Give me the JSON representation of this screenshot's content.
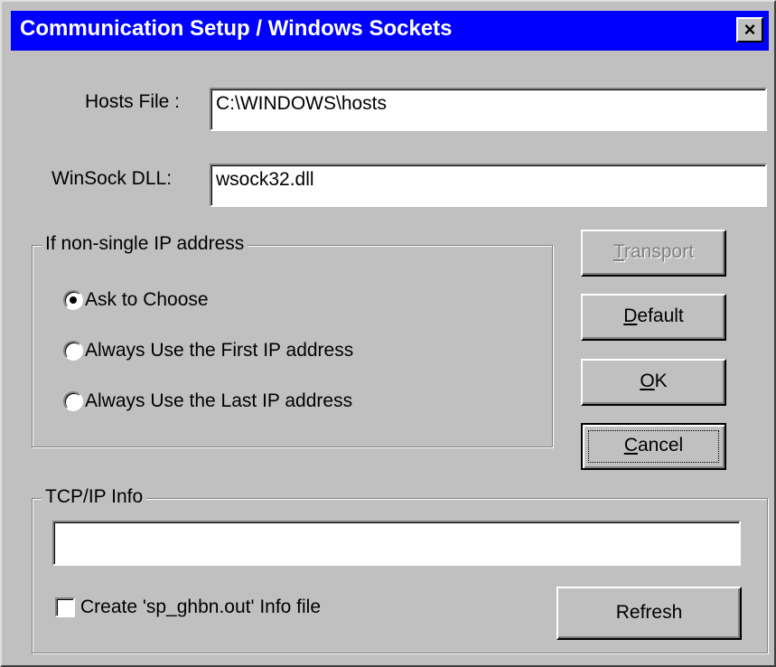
{
  "window": {
    "title": "Communication Setup / Windows Sockets",
    "close_glyph": "×"
  },
  "hosts_file": {
    "label": "Hosts File :",
    "value": "C:\\WINDOWS\\hosts"
  },
  "winsock_dll": {
    "label": "WinSock DLL:",
    "value": "wsock32.dll"
  },
  "ip_group": {
    "legend": "If non-single IP address",
    "options": [
      {
        "label": "Ask to Choose",
        "checked": true
      },
      {
        "label": "Always Use the First IP address",
        "checked": false
      },
      {
        "label": "Always Use the Last IP address",
        "checked": false
      }
    ]
  },
  "buttons": {
    "transport": {
      "mnemonic": "T",
      "rest": "ransport",
      "enabled": false
    },
    "default": {
      "mnemonic": "D",
      "rest": "efault"
    },
    "ok": {
      "mnemonic": "O",
      "rest": "K"
    },
    "cancel": {
      "mnemonic": "C",
      "rest": "ancel"
    }
  },
  "tcpip_group": {
    "legend": "TCP/IP Info",
    "info_value": "",
    "checkbox_label": "Create 'sp_ghbn.out' Info file",
    "checkbox_checked": false,
    "refresh_label": "Refresh"
  },
  "colors": {
    "titlebar": "#0000ff",
    "face": "#c0c0c0"
  }
}
